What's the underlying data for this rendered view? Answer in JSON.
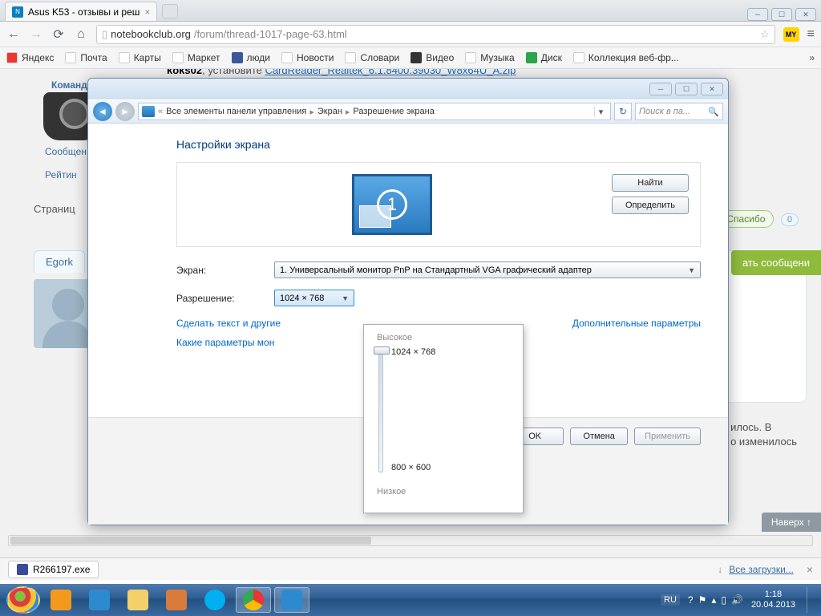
{
  "browser": {
    "tab_title": "Asus K53 - отзывы и реш",
    "url_host": "notebookclub.org",
    "url_path": "/forum/thread-1017-page-63.html",
    "ext_badge": "MY"
  },
  "bookmarks": [
    "Яндекс",
    "Почта",
    "Карты",
    "Маркет",
    "люди",
    "Новости",
    "Словари",
    "Видео",
    "Музыка",
    "Диск",
    "Коллекция веб-фр..."
  ],
  "forum": {
    "team_label": "Команда сайта",
    "side_msg": "Сообщен",
    "side_rating": "Рейтин",
    "post_user": "koks02",
    "post_text": ", установите ",
    "post_link": "CardReader_Realtek_6.1.8400.39030_W8x64U_A.zip",
    "thanks": "Спасибо",
    "thanks_n": "0",
    "page_lbl": "Страниц",
    "green_btn": "ать сообщени",
    "user2": "Egork",
    "frag1": "илось. В",
    "frag2": "о изменилось",
    "top_btn": "Наверх ↑"
  },
  "downloads": {
    "file": "R266197.exe",
    "all": "Все загрузки..."
  },
  "cp": {
    "bc_root": "Все элементы панели управления",
    "bc_screen": "Экран",
    "bc_res": "Разрешение экрана",
    "search_ph": "Поиск в па...",
    "heading": "Настройки экрана",
    "find": "Найти",
    "detect": "Определить",
    "lbl_screen": "Экран:",
    "combo_screen": "1. Универсальный монитор PnP на Стандартный VGA графический адаптер",
    "lbl_res": "Разрешение:",
    "combo_res": "1024 × 768",
    "link_text": "Сделать текст и другие",
    "link_params": "Какие параметры мон",
    "link_adv": "Дополнительные параметры",
    "ok": "OK",
    "cancel": "Отмена",
    "apply": "Применить",
    "popup": {
      "high": "Высокое",
      "low": "Низкое",
      "opt1": "1024 × 768",
      "opt2": "800 × 600"
    }
  },
  "tray": {
    "lang": "RU",
    "time": "1:18",
    "date": "20.04.2013"
  }
}
